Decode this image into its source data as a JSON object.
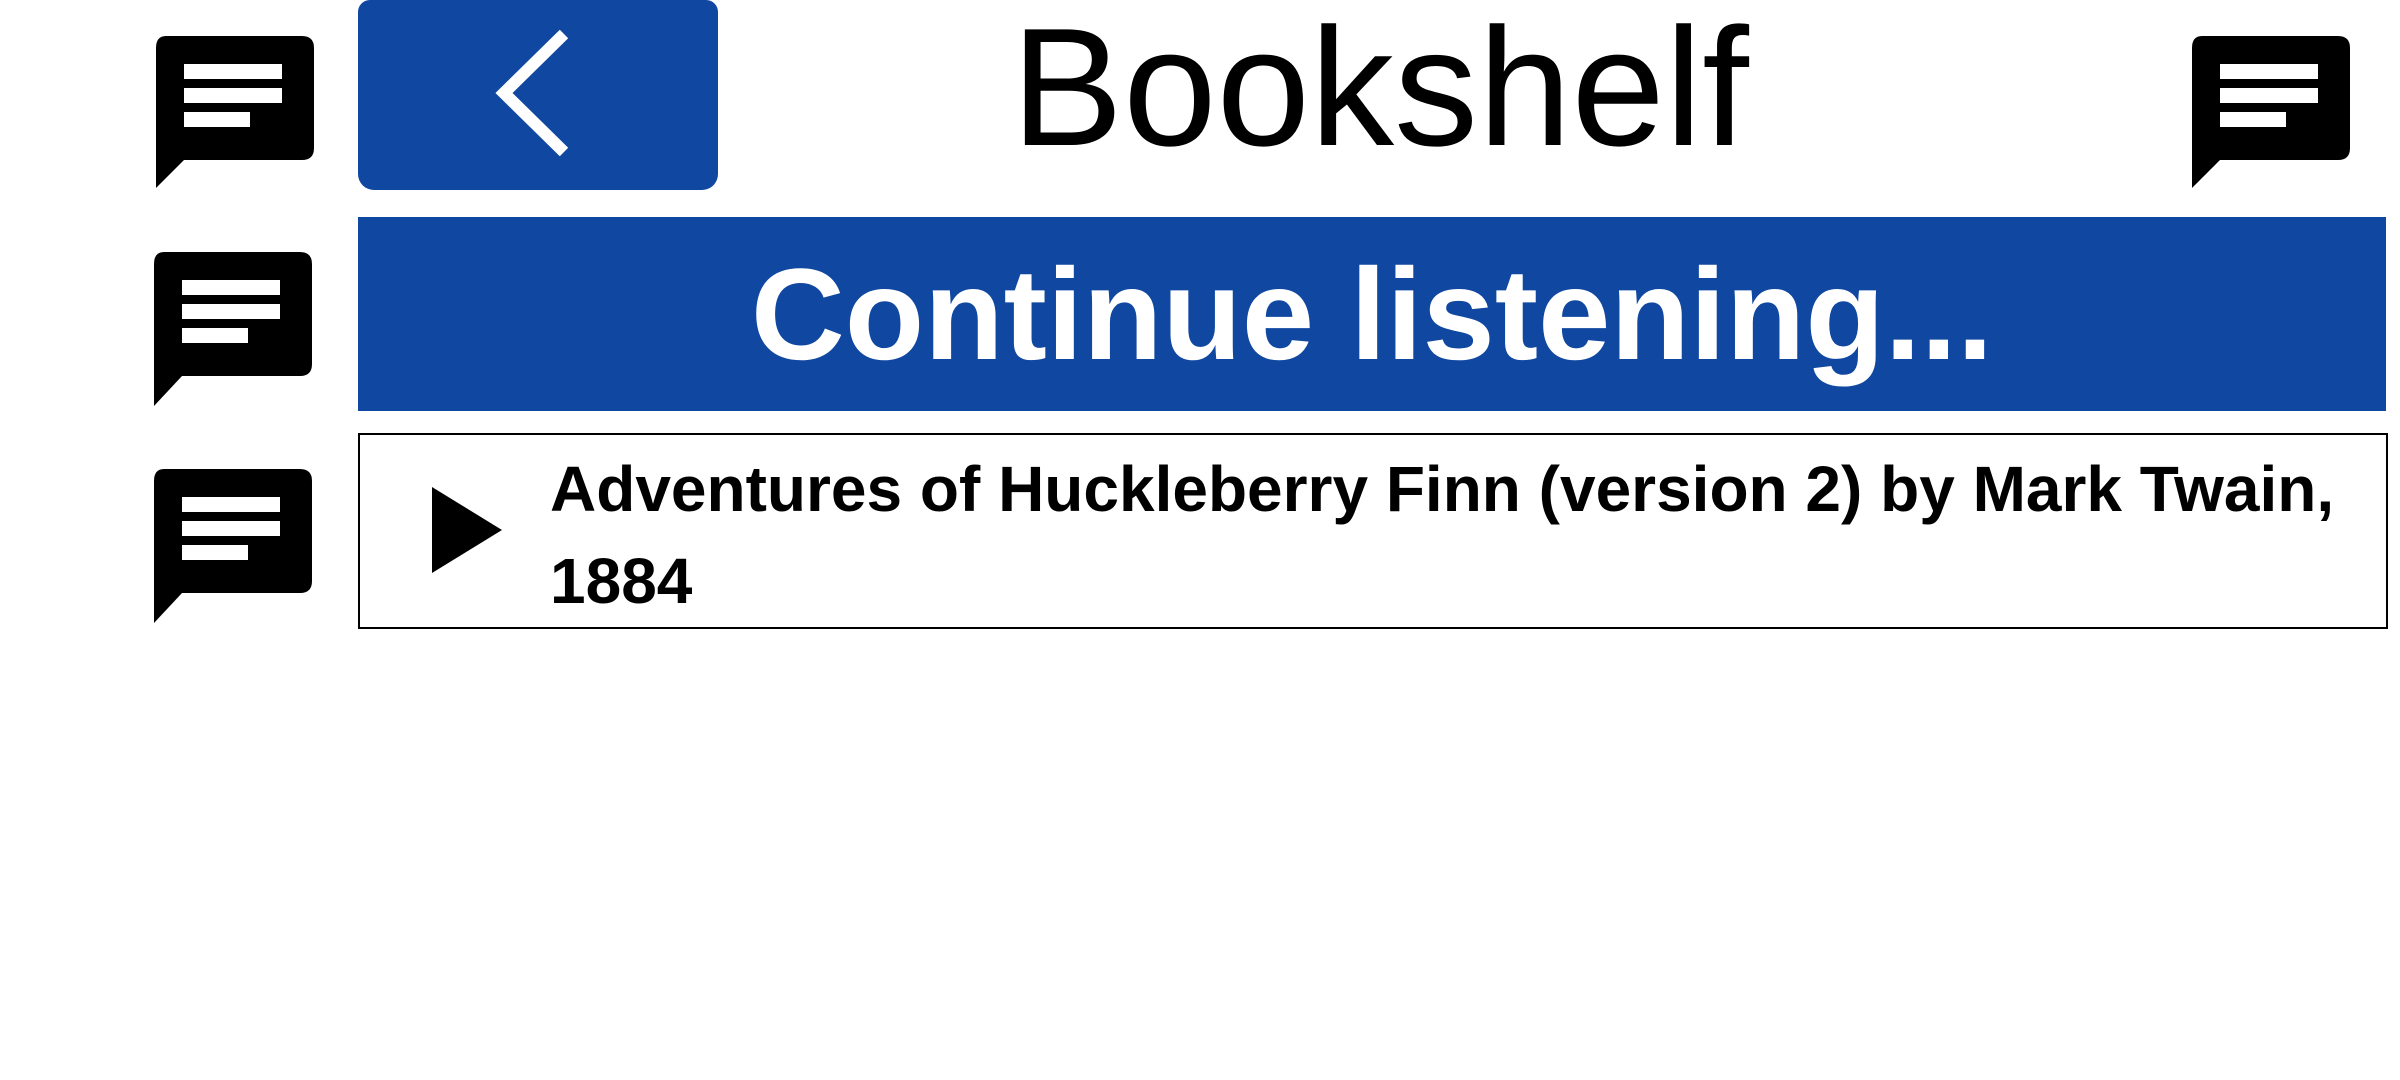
{
  "header": {
    "title": "Bookshelf",
    "back_icon": "chevron-left-icon"
  },
  "banner": {
    "label": "Continue listening..."
  },
  "books": [
    {
      "title": "Adventures of Huckleberry Finn (version 2) by Mark Twain, 1884",
      "icon": "play-icon"
    }
  ],
  "icons": {
    "speech": "speech-bubble-icon"
  },
  "colors": {
    "accent": "#0f47a1",
    "text": "#000000",
    "background": "#ffffff"
  }
}
